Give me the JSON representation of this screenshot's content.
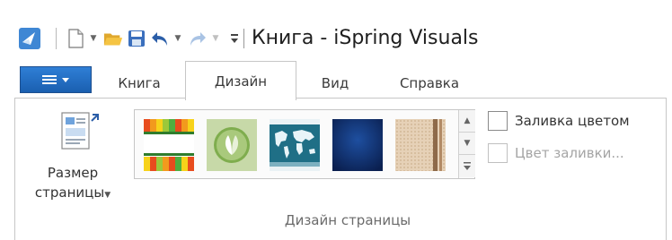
{
  "window": {
    "title": "Книга - iSpring Visuals"
  },
  "quick_access": {
    "items": [
      "app-icon",
      "new-document-icon",
      "open-folder-icon",
      "save-icon",
      "undo-icon",
      "redo-icon",
      "customize-toolbar-icon"
    ]
  },
  "tabs": [
    {
      "label": "Книга",
      "active": false
    },
    {
      "label": "Дизайн",
      "active": true
    },
    {
      "label": "Вид",
      "active": false
    },
    {
      "label": "Справка",
      "active": false
    }
  ],
  "ribbon": {
    "page_size": {
      "line1": "Размер",
      "line2": "страницы"
    },
    "gallery": {
      "themes": [
        "rainbow-stripes-theme",
        "green-leaf-theme",
        "world-map-theme",
        "dark-blue-theme",
        "beige-pattern-theme"
      ],
      "scroll_up": "▲",
      "scroll_down": "▼",
      "more": "▼"
    },
    "fill_color_checkbox": {
      "label": "Заливка цветом",
      "checked": false
    },
    "fill_color_picker": {
      "label": "Цвет заливки...",
      "enabled": false
    },
    "group_label": "Дизайн страницы"
  },
  "colors": {
    "file_button": "#2a74c8",
    "accent_blue": "#1a5fb0",
    "border": "#c6c6c6"
  }
}
